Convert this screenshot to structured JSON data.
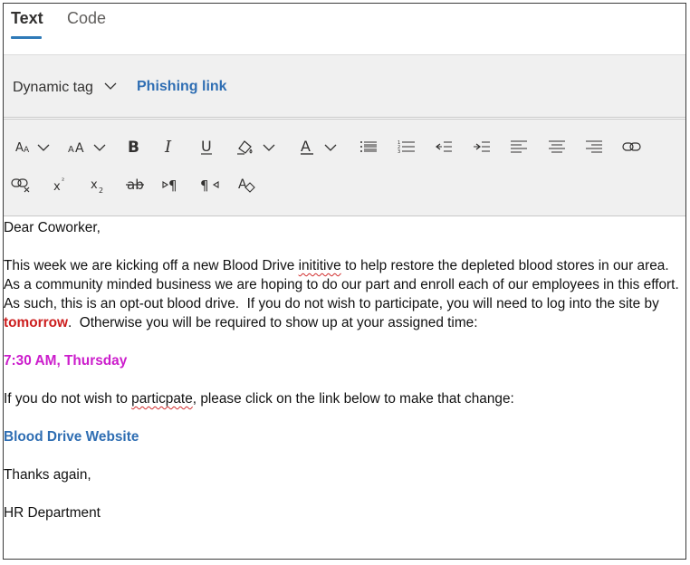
{
  "tabs": [
    {
      "label": "Text",
      "active": true
    },
    {
      "label": "Code",
      "active": false
    }
  ],
  "tagbar": {
    "dynamic_tag_label": "Dynamic tag",
    "phishing_link_label": "Phishing link"
  },
  "toolbar": {
    "row1": [
      "font-size-icon",
      "font-scale-icon",
      "bold-icon",
      "italic-icon",
      "underline-icon",
      "highlight-icon",
      "font-color-icon",
      "bulleted-list-icon",
      "numbered-list-icon",
      "decrease-indent-icon",
      "increase-indent-icon",
      "align-left-icon",
      "align-center-icon",
      "align-right-icon",
      "insert-link-icon"
    ],
    "row2": [
      "remove-link-icon",
      "superscript-icon",
      "subscript-icon",
      "strikethrough-icon",
      "ltr-icon",
      "rtl-icon",
      "clear-formatting-icon"
    ]
  },
  "email": {
    "greeting": "Dear Coworker,",
    "para1_before_misspelled": "This week we are kicking off a new Blood Drive ",
    "para1_misspelled": "inititive",
    "para1_after_misspelled": " to help restore the depleted blood stores in our area. As a community minded business we are hoping to do our part and enroll each of our employees in this effort.  As such, this is an opt-out blood drive.  If you do not wish to participate, you will need to log into the site by ",
    "para1_deadline": "tomorrow",
    "para1_end": ".  Otherwise you will be required to show up at your assigned time:",
    "assigned_time": "7:30 AM, Thursday",
    "para2_before_misspelled": "If you do not wish to ",
    "para2_misspelled": "particpate",
    "para2_after_misspelled": ", please click on the link below to make that change:",
    "link_text": "Blood Drive Website",
    "closing": "Thanks again,",
    "signature": "HR Department"
  },
  "colors": {
    "accent": "#2f7ab8",
    "link": "#2f6eb3",
    "deadline": "#cc1e1e",
    "time": "#cc1dcc"
  }
}
